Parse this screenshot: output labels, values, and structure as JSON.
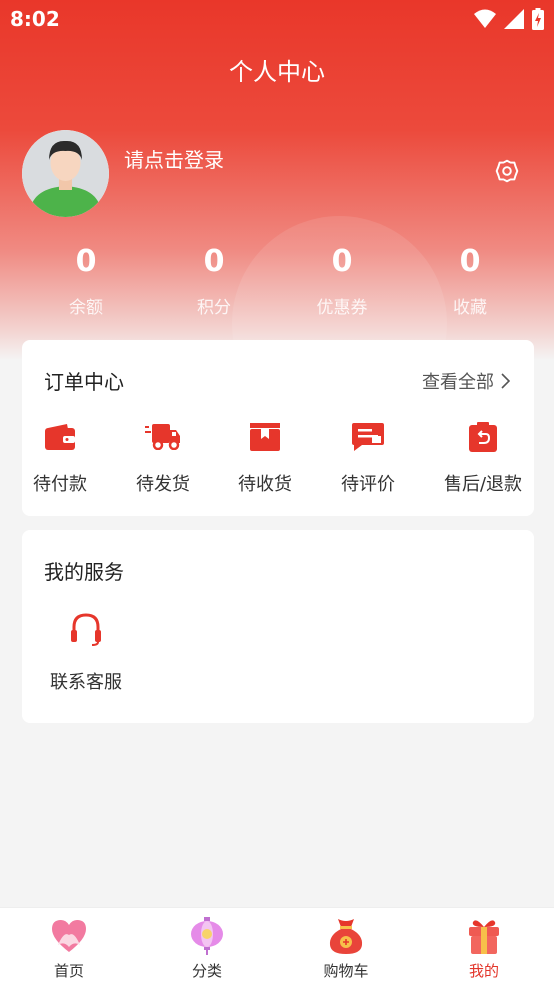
{
  "status_bar": {
    "time": "8:02"
  },
  "header": {
    "title": "个人中心"
  },
  "profile": {
    "login_prompt": "请点击登录"
  },
  "stats": [
    {
      "value": "0",
      "label": "余额"
    },
    {
      "value": "0",
      "label": "积分"
    },
    {
      "value": "0",
      "label": "优惠券"
    },
    {
      "value": "0",
      "label": "收藏"
    }
  ],
  "order_center": {
    "title": "订单中心",
    "view_all": "查看全部",
    "items": [
      {
        "label": "待付款",
        "icon": "wallet-icon"
      },
      {
        "label": "待发货",
        "icon": "truck-icon"
      },
      {
        "label": "待收货",
        "icon": "package-icon"
      },
      {
        "label": "待评价",
        "icon": "comment-icon"
      },
      {
        "label": "售后/退款",
        "icon": "refund-icon"
      }
    ]
  },
  "services": {
    "title": "我的服务",
    "items": [
      {
        "label": "联系客服",
        "icon": "headset-icon"
      }
    ]
  },
  "tabbar": [
    {
      "label": "首页",
      "icon": "heart-icon"
    },
    {
      "label": "分类",
      "icon": "lantern-icon"
    },
    {
      "label": "购物车",
      "icon": "money-bag-icon"
    },
    {
      "label": "我的",
      "icon": "gift-icon",
      "active": true
    }
  ],
  "colors": {
    "primary": "#e9372a",
    "active_tab": "#e3352a",
    "background": "#f4f4f4"
  }
}
